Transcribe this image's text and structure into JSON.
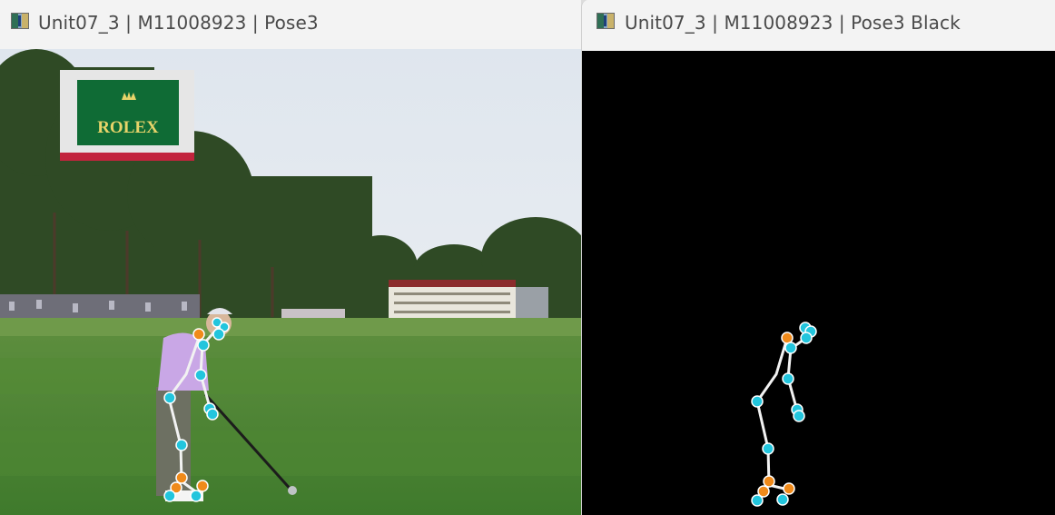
{
  "windows": [
    {
      "title": "Unit07_3 | M11008923 | Pose3",
      "icon": "app-icon",
      "content": {
        "sign_text": "ROLEX",
        "sign_color": "#0f6b35",
        "sign_text_color": "#e8d46a"
      }
    },
    {
      "title": "Unit07_3 | M11008923 | Pose3 Black",
      "icon": "app-icon",
      "content": {
        "background": "#000000"
      }
    }
  ],
  "pose_colors": {
    "joint": "#22c5dd",
    "key_joint": "#f08a1a",
    "bone": "#f2f2f2"
  }
}
